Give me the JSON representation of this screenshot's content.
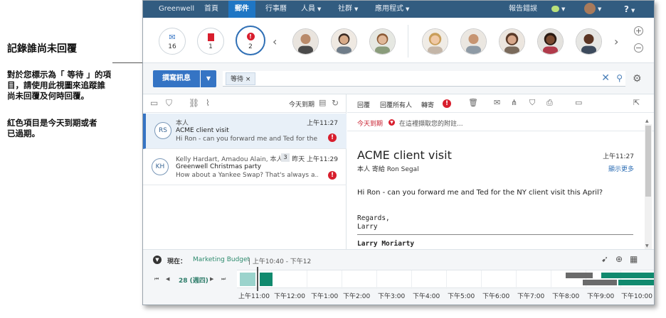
{
  "annotation": {
    "title": "記錄誰尚未回覆",
    "para1_line1": "對於您標示為「 等待 」的項",
    "para1_line2": "目，請使用此視圖來追蹤誰",
    "para1_line3": "尚未回覆及何時回覆。",
    "para2_line1": "紅色項目是今天到期或者",
    "para2_line2": "已過期。"
  },
  "navbar": {
    "brand": "Greenwell",
    "home": "首頁",
    "mail": "郵件",
    "calendar": "行事曆",
    "people": "人員",
    "communities": "社群",
    "apps": "應用程式",
    "report": "報告錯誤",
    "help": "?"
  },
  "counters": [
    {
      "icon": "envelope-icon",
      "count": "16"
    },
    {
      "icon": "flag-icon",
      "count": "1"
    },
    {
      "icon": "alert-icon",
      "count": "2"
    }
  ],
  "toolbar": {
    "compose_label": "撰寫訊息",
    "filter_chip": "等待 ×"
  },
  "list": {
    "sort_label": "今天到期",
    "messages": [
      {
        "initials": "RS",
        "from": "本人",
        "subject": "ACME client visit",
        "snippet": "Hi Ron - can you forward me and Ted for the...",
        "time": "上午11:27"
      },
      {
        "initials": "KH",
        "from": "Kelly Hardart, Amadou Alain, 本人",
        "count": "3",
        "subject": "Greenwell Christmas party",
        "snippet": "How about a Yankee Swap? That's always a...",
        "time": "昨天 上午11:29"
      }
    ]
  },
  "reader": {
    "reply": "回覆",
    "reply_all": "回覆所有人",
    "forward": "轉寄",
    "due_label": "今天到期",
    "attachment_prompt": "在這裡擷取您的附註...",
    "subject": "ACME client visit",
    "sender_line": "本人 寄給 Ron Segal",
    "time": "上午11:27",
    "show_more": "顯示更多",
    "body": "Hi Ron - can you forward me and Ted for the NY client visit this April?",
    "regards": "Regards,",
    "sign_name": "Larry",
    "sig_full": "Larry Moriarty"
  },
  "calendar": {
    "now_label": "現在：",
    "meeting": "Marketing Budget",
    "meeting_time": "| 上午10:40 - 下午12",
    "day_label": "28 (週四)",
    "hours": [
      "上午11:00",
      "下午12:00",
      "下午1:00",
      "下午2:00",
      "下午3:00",
      "下午4:00",
      "下午5:00",
      "下午6:00",
      "下午7:00",
      "下午8:00",
      "下午9:00",
      "下午10:00"
    ],
    "colors": {
      "teal_light": "#9bd3cc",
      "teal_dark": "#118a6e",
      "gray": "#6b6b6b"
    }
  },
  "colors": {
    "nav": "#325c80",
    "accent": "#3574c4",
    "alert": "#d81e2d"
  }
}
